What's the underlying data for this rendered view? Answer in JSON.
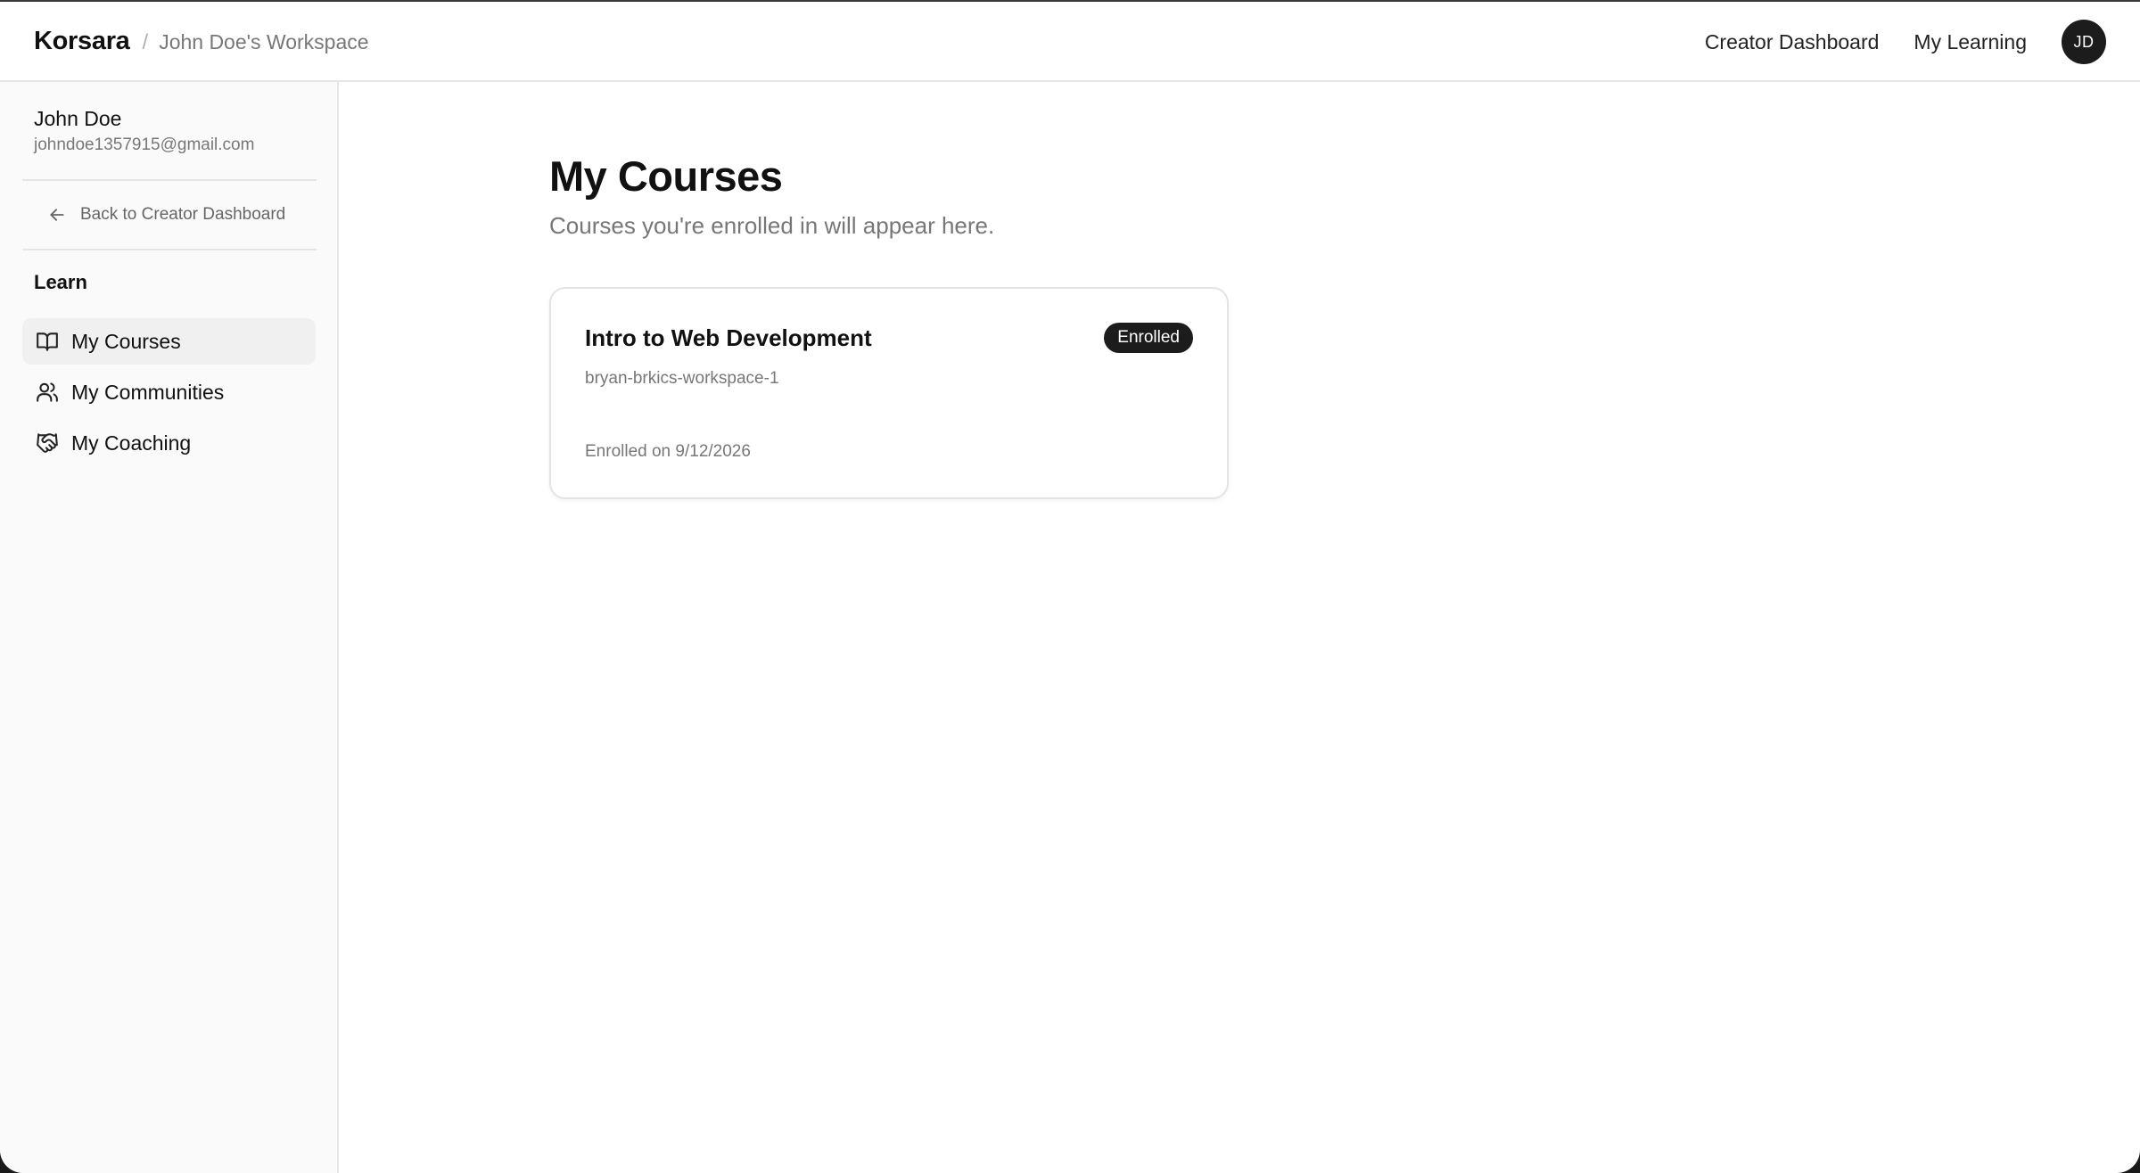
{
  "header": {
    "brand": "Korsara",
    "separator": "/",
    "workspace": "John Doe's Workspace",
    "nav": {
      "creator_dashboard": "Creator Dashboard",
      "my_learning": "My Learning"
    },
    "avatar_initials": "JD"
  },
  "sidebar": {
    "user": {
      "name": "John Doe",
      "email": "johndoe1357915@gmail.com"
    },
    "back_link": {
      "label": "Back to Creator Dashboard",
      "icon": "arrow-left-icon"
    },
    "section_label": "Learn",
    "items": [
      {
        "label": "My Courses",
        "icon": "book-open-icon",
        "active": true
      },
      {
        "label": "My Communities",
        "icon": "users-icon",
        "active": false
      },
      {
        "label": "My Coaching",
        "icon": "handshake-icon",
        "active": false
      }
    ]
  },
  "main": {
    "title": "My Courses",
    "subtitle": "Courses you're enrolled in will appear here.",
    "courses": [
      {
        "title": "Intro to Web Development",
        "badge": "Enrolled",
        "workspace": "bryan-brkics-workspace-1",
        "enrolled": "Enrolled on 9/12/2026"
      }
    ]
  },
  "colors": {
    "accent_dark": "#1c1c1c",
    "muted_text": "#777777",
    "sidebar_bg": "#fafafa",
    "active_item_bg": "#f0f0f0",
    "border": "#e4e4e4"
  }
}
